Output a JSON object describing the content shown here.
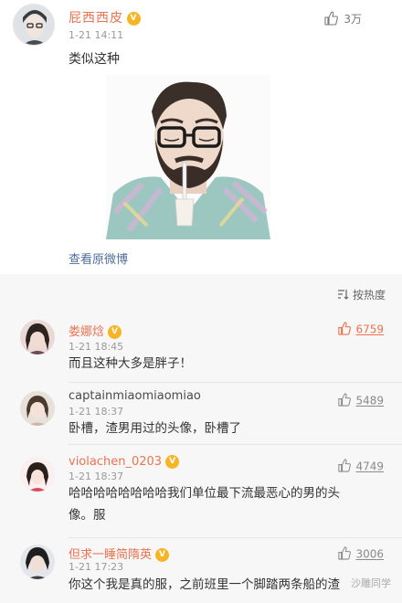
{
  "post": {
    "author": "屁西西皮",
    "time": "1-21 14:11",
    "likes": "3万",
    "text": "类似这种",
    "view_link": "查看原微博"
  },
  "sort": {
    "label": "按热度"
  },
  "comments": [
    {
      "author": "娄娜焓",
      "vip": true,
      "time": "1-21 18:45",
      "likes": "6759",
      "liked": true,
      "lines": [
        "而且这种大多是胖子！"
      ]
    },
    {
      "author": "captainmiaomiaomiao",
      "vip": false,
      "time": "1-21 18:37",
      "likes": "5489",
      "liked": false,
      "lines": [
        "卧槽，渣男用过的头像，卧槽了"
      ]
    },
    {
      "author": "violachen_0203",
      "vip": true,
      "time": "1-21 18:37",
      "likes": "4749",
      "liked": false,
      "lines": [
        "哈哈哈哈哈哈哈哈我们单位最下流最恶心的男的头",
        "像。服"
      ]
    },
    {
      "author": "但求一睡简隋英",
      "vip": true,
      "time": "1-21 17:23",
      "likes": "3006",
      "liked": false,
      "lines": [
        "你这个我是真的服，之前班里一个脚踏两条船的渣"
      ]
    }
  ],
  "watermark": "沙雕同学",
  "colors": {
    "accent": "#eb7350",
    "link": "#4e6d9c",
    "vip_badge": "#f7b526",
    "muted": "#999999"
  },
  "icons": {
    "like": "thumbs-up-icon",
    "sort": "sort-icon",
    "vip": "vip-crown-icon"
  }
}
